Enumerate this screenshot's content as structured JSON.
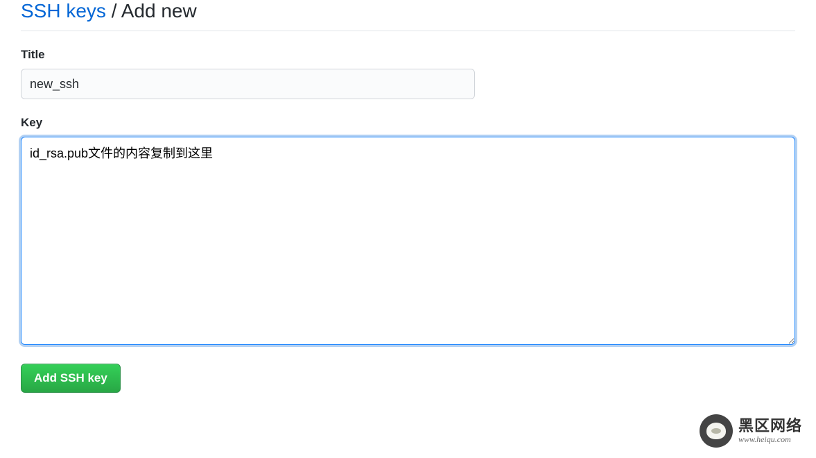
{
  "header": {
    "link_text": "SSH keys",
    "separator": " / ",
    "current": "Add new"
  },
  "form": {
    "title": {
      "label": "Title",
      "value": "new_ssh"
    },
    "key": {
      "label": "Key",
      "value": "id_rsa.pub文件的内容复制到这里"
    },
    "submit_label": "Add SSH key"
  },
  "watermark": {
    "title": "黑区网络",
    "url": "www.heiqu.com"
  }
}
